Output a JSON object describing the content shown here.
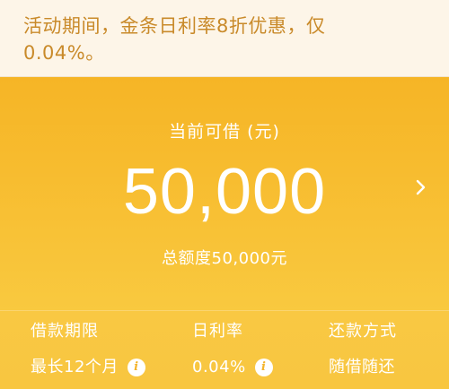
{
  "promo": {
    "line1": "活动期间，金条日利率8折优惠，仅",
    "line2": "0.04%。"
  },
  "hero": {
    "label": "当前可借 (元)",
    "amount": "50,000",
    "total": "总额度50,000元"
  },
  "stats": {
    "term": {
      "title": "借款期限",
      "value": "最长12个月"
    },
    "rate": {
      "title": "日利率",
      "value": "0.04%"
    },
    "repay": {
      "title": "还款方式",
      "value": "随借随还"
    }
  },
  "icons": {
    "info": "i",
    "chevron": "chevron-right-icon"
  },
  "colors": {
    "accent": "#f6b526",
    "promo_text": "#c98a2a",
    "promo_bg": "#fdf5e8"
  }
}
